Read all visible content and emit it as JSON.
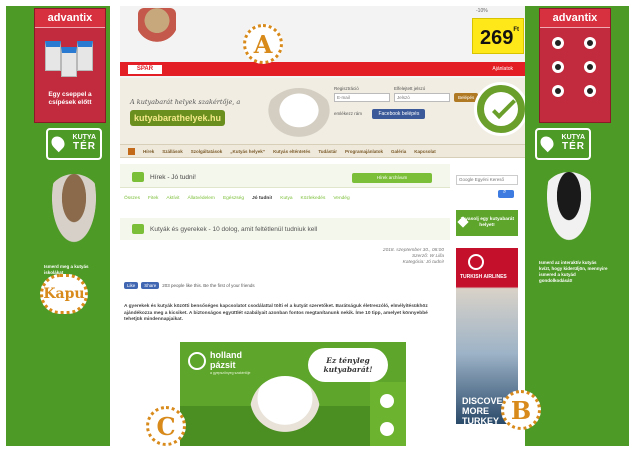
{
  "left_ad": {
    "brand": "advantix",
    "caption": "Egy cseppel a csípések előtt"
  },
  "right_ad": {
    "brand": "advantix"
  },
  "kutyater": {
    "line1": "KUTYA",
    "line2": "TÉR"
  },
  "left_promo_text": "Ismerd meg a kutyás iskolákat",
  "right_promo_text": "Ismerd az interaktív kutyás kvízt, hogy kiderüljön, mennyire ismered a kutyád gondolkodását!",
  "labels": {
    "a": "A",
    "b": "B",
    "c": "C",
    "kapu": "Kapu"
  },
  "top_ad": {
    "price": "269",
    "currency": "Ft",
    "old_price": "-10%",
    "spar": "SPAR",
    "cta": "Ajánlatok"
  },
  "header": {
    "tagline": "A kutyabarát helyek szakértője, a",
    "logo": "kutyabarathelyek.hu",
    "login_label": "Regisztráció",
    "password_label": "Elfelejtett jelszó",
    "email_placeholder": "E-mail",
    "password_placeholder": "Jelszó",
    "login_button": "Belépés",
    "remember": "emlékezz rám",
    "facebook": "Facebook belépés"
  },
  "nav": [
    "Hírek",
    "Szállások",
    "Szolgáltatások",
    "„Kutyás helyek”",
    "Kutyás elténtetés",
    "Tudástár",
    "Programajánlatok",
    "Galéria",
    "Kapcsolat"
  ],
  "section": {
    "title": "Hírek - Jó tudni!",
    "all_button": "Hírek archívum"
  },
  "categories": [
    "Összes",
    "Fitek",
    "Aktívit",
    "Állatvédelem",
    "Egészség",
    "Jó tudni!",
    "Kutya",
    "Közlekedés",
    "Vendég"
  ],
  "active_category": "Jó tudni!",
  "article": {
    "title": "Kutyák és gyerekek - 10 dolog, amit feltétlenül tudniuk kell",
    "date": "2018. szeptember 30., 08:00",
    "author": "Szerző: W Lilla",
    "category": "Kategória: Jó tudni!",
    "like": "Like",
    "share": "Share",
    "social_text": "203 people like this. Be the first of your friends",
    "lead": "A gyerekek és kutyák közötti bensőséges kapcsolatot csodálattal tölti el a kutyát szeretőket. Barátságuk életreszóló, elmélyítésükhöz ajándékozza meg a kicsiket. A biztonságos együttlét szabályait azonban fontos megtanítanunk nekik. Íme 10 tipp, amelyet könnyebbé tehetjük mindennapjaikat."
  },
  "holland_ad": {
    "name1": "holland",
    "name2": "pázsit",
    "sub": "a gyepszőnyeg szakértője",
    "bubble": "Ez tényleg kutyabarát!"
  },
  "sidebar": {
    "search_placeholder": "Google Egyéni Kereső",
    "suggest": "Javasolj egy kutyabarát helyet!",
    "thy_name": "TURKISH AIRLINES",
    "thy_tagline": "DISCOVER MORE TURKEY"
  }
}
